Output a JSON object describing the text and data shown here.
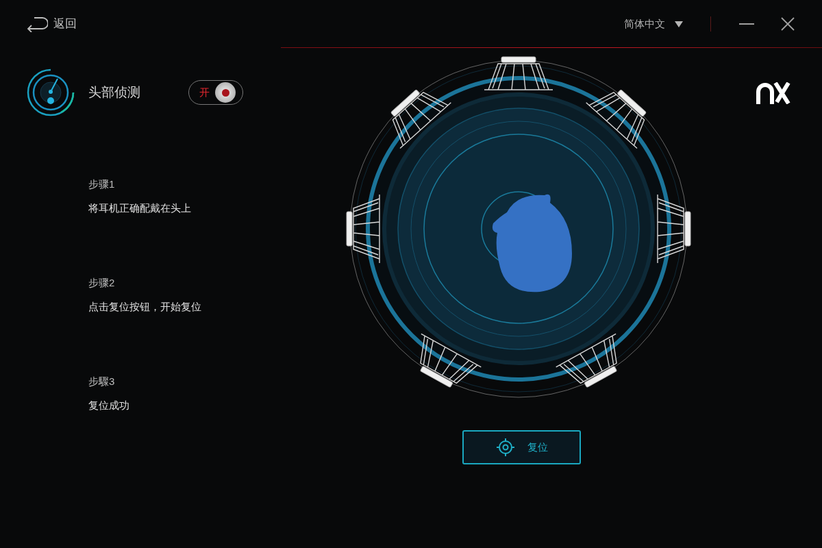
{
  "back": {
    "label": "返回"
  },
  "language": {
    "label": "简体中文"
  },
  "head_tracking": {
    "title": "头部侦测",
    "toggle": {
      "label": "开",
      "on": true
    }
  },
  "steps": [
    {
      "title": "步骤1",
      "text": "将耳机正确配戴在头上"
    },
    {
      "title": "步骤2",
      "text": "点击复位按钮，开始复位"
    },
    {
      "title": "步驟3",
      "text": "复位成功"
    }
  ],
  "reset_button": {
    "label": "复位"
  }
}
